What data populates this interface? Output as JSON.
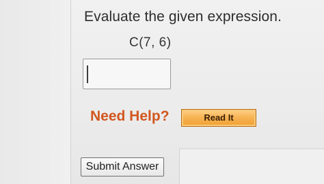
{
  "question": {
    "prompt": "Evaluate the given expression.",
    "expression": "C(7, 6)",
    "answer_value": ""
  },
  "help": {
    "label": "Need Help?",
    "read_it_label": "Read It"
  },
  "actions": {
    "submit_label": "Submit Answer"
  },
  "colors": {
    "help_text": "#d2561e",
    "read_it_button": "#f5ad45"
  }
}
